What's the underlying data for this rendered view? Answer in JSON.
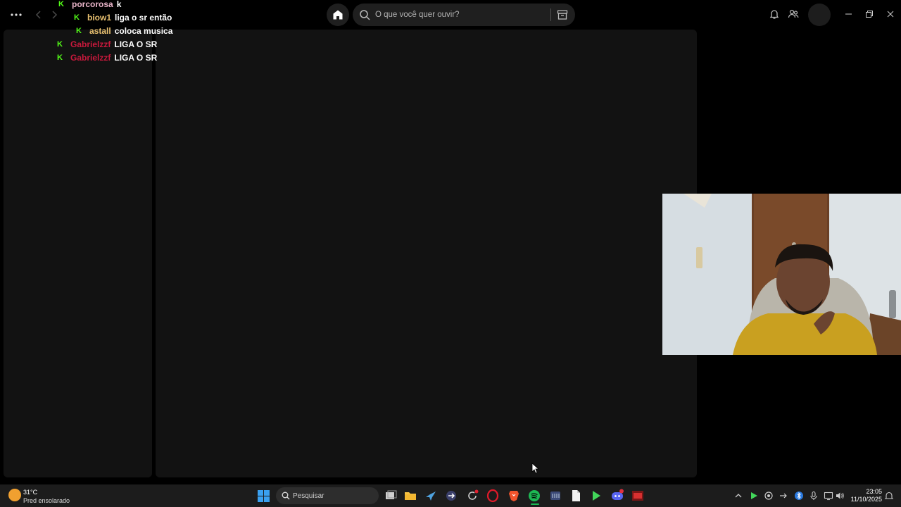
{
  "topbar": {
    "search_placeholder": "O que você quer ouvir?"
  },
  "chat": [
    {
      "user": "porcorosa",
      "message": "k",
      "user_color": "#e8b4c8"
    },
    {
      "user": "biow1",
      "message": "liga o sr então",
      "user_color": "#e8c070"
    },
    {
      "user": "astall",
      "message": "coloca musica",
      "user_color": "#e8c070"
    },
    {
      "user": "Gabrielzzf",
      "message": "LIGA O SR",
      "user_color": "#c8193c"
    },
    {
      "user": "Gabrielzzf",
      "message": "LIGA O SR",
      "user_color": "#c8193c"
    }
  ],
  "chat_badge": "K",
  "taskbar": {
    "weather_temp": "31°C",
    "weather_desc": "Pred ensolarado",
    "search_placeholder": "Pesquisar",
    "time": "23:05",
    "date": "11/10/2025",
    "apps": [
      "task-view",
      "file-explorer",
      "steam",
      "app-arrow",
      "app-refresh",
      "opera",
      "brave",
      "spotify",
      "app-grid",
      "notepad",
      "play-app",
      "discord",
      "app-game"
    ]
  },
  "colors": {
    "spotify_green": "#1db954",
    "kick_green": "#53fc18",
    "panel_bg": "#121212"
  }
}
